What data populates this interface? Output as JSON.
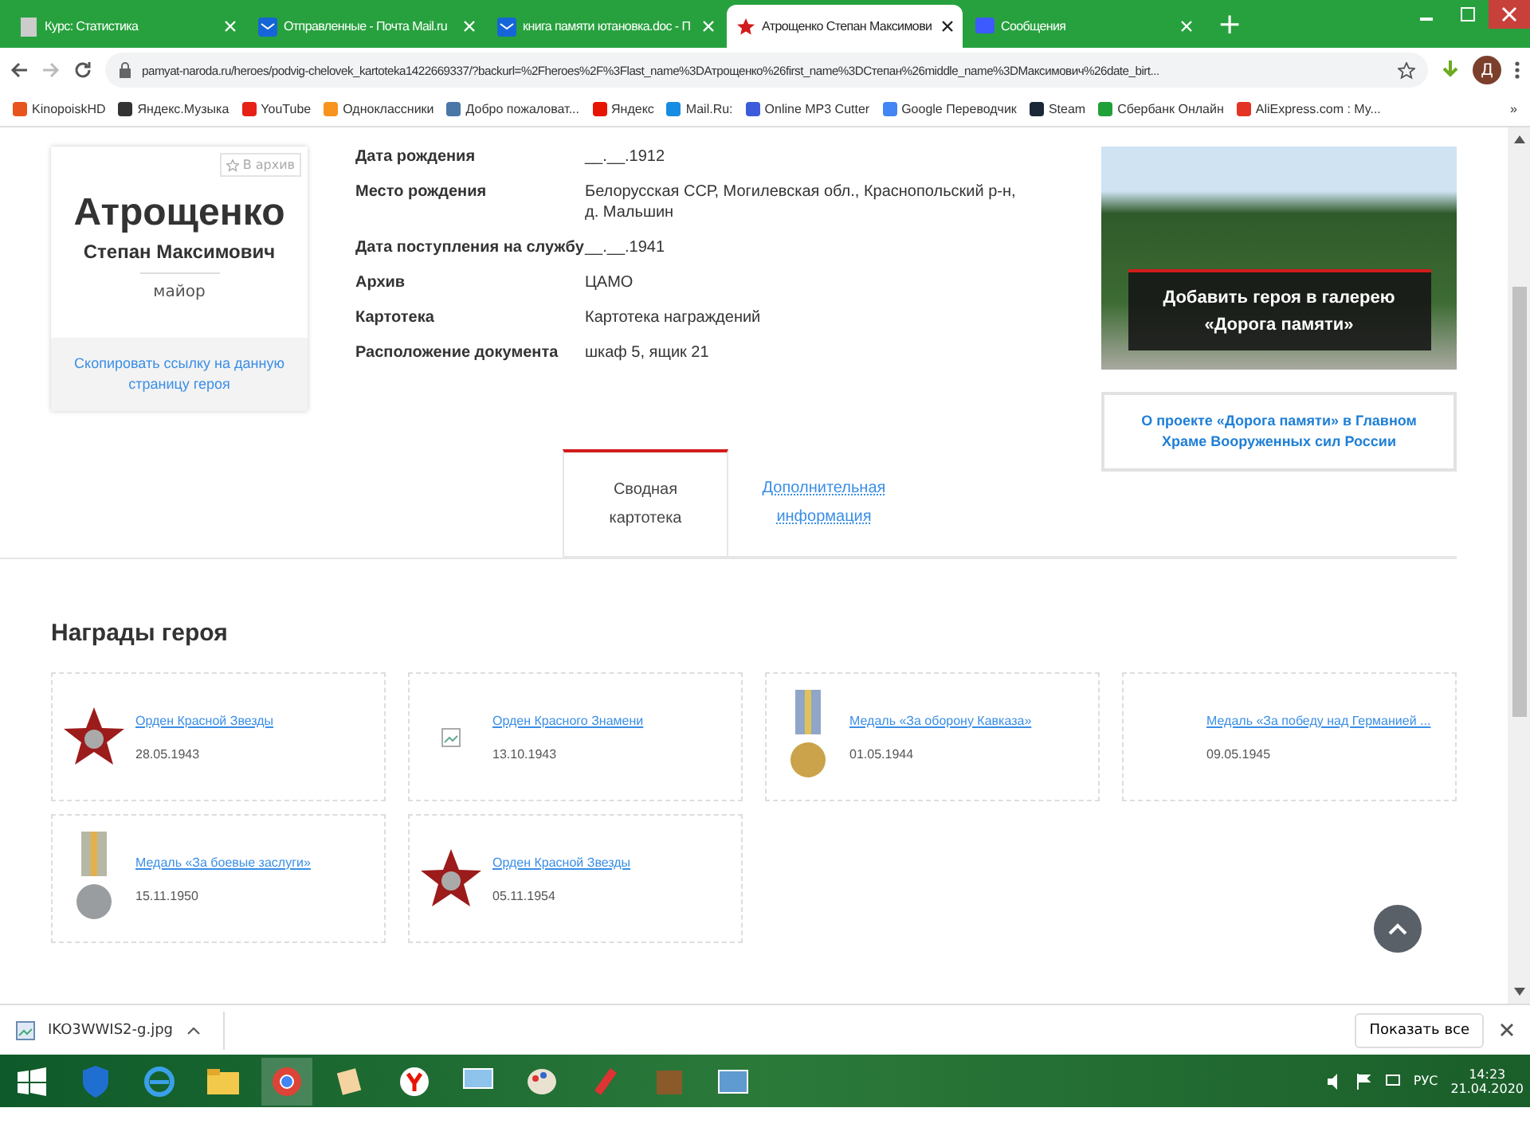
{
  "browser": {
    "tabs": [
      {
        "title": "Курс: Статистика",
        "selected": false,
        "kind": "doc"
      },
      {
        "title": "Отправленные - Почта Mail.ru",
        "selected": false,
        "kind": "mail"
      },
      {
        "title": "книга памяти ютановка.doc - П",
        "selected": false,
        "kind": "mail"
      },
      {
        "title": "Атрощенко Степан Максимови",
        "selected": true,
        "kind": "star"
      },
      {
        "title": "Сообщения",
        "selected": false,
        "kind": "chat"
      }
    ],
    "new_tab": "+",
    "url": "pamyat-naroda.ru/heroes/podvig-chelovek_kartoteka1422669337/?backurl=%2Fheroes%2F%3Flast_name%3DАтрощенко%26first_name%3DСтепан%26middle_name%3DМаксимович%26date_birt...",
    "profile": "Д",
    "bookmarks": [
      {
        "title": "KinopoiskHD",
        "color": "#e8541e"
      },
      {
        "title": "Яндекс.Музыка",
        "color": "#333333"
      },
      {
        "title": "YouTube",
        "color": "#e62117"
      },
      {
        "title": "Одноклассники",
        "color": "#f7931e"
      },
      {
        "title": "Добро пожаловат...",
        "color": "#4a76a8"
      },
      {
        "title": "Яндекс",
        "color": "#e61400"
      },
      {
        "title": "Mail.Ru:",
        "color": "#168de2"
      },
      {
        "title": "Online MP3 Cutter",
        "color": "#3b5bdb"
      },
      {
        "title": "Google Переводчик",
        "color": "#4285f4"
      },
      {
        "title": "Steam",
        "color": "#1b2838"
      },
      {
        "title": "Сбербанк Онлайн",
        "color": "#21a038"
      },
      {
        "title": "AliExpress.com : My...",
        "color": "#e43225"
      }
    ],
    "more": "»"
  },
  "hero": {
    "archive_button": "В архив",
    "surname": "Атрощенко",
    "names": "Степан Максимович",
    "rank": "майор",
    "copy_link": "Скопировать ссылку на данную страницу героя"
  },
  "details": [
    {
      "label": "Дата рождения",
      "value": "__.__.1912"
    },
    {
      "label": "Место рождения",
      "value": "Белорусская ССР, Могилевская обл., Краснопольский р-н, д. Мальшин"
    },
    {
      "label": "Дата поступления на службу",
      "value": "__.__.1941"
    },
    {
      "label": "Архив",
      "value": "ЦАМО"
    },
    {
      "label": "Картотека",
      "value": "Картотека награждений"
    },
    {
      "label": "Расположение документа",
      "value": "шкаф 5, ящик 21"
    }
  ],
  "gallery_banner": {
    "text": "Добавить героя в галерею «Дорога памяти»"
  },
  "about_link": "О проекте «Дорога памяти» в Главном Храме Вооруженных сил России",
  "page_tabs": [
    {
      "label": "Сводная картотека",
      "selected": true
    },
    {
      "label": "Дополнительная информация",
      "selected": false
    }
  ],
  "awards": {
    "title": "Награды героя",
    "items": [
      {
        "name": "Орден Красной Звезды",
        "date": "28.05.1943",
        "kind": "star"
      },
      {
        "name": "Орден Красного Знамени",
        "date": "13.10.1943",
        "kind": "broken"
      },
      {
        "name": "Медаль «За оборону Кавказа»",
        "date": "01.05.1944",
        "kind": "gold"
      },
      {
        "name": "Медаль «За победу над Германией ...",
        "date": "09.05.1945",
        "kind": "none"
      },
      {
        "name": "Медаль «За боевые заслуги»",
        "date": "15.11.1950",
        "kind": "silver"
      },
      {
        "name": "Орден Красной Звезды",
        "date": "05.11.1954",
        "kind": "star"
      }
    ]
  },
  "downloads": {
    "file": "IKO3WWIS2-g.jpg",
    "show_all": "Показать все"
  },
  "taskbar": {
    "language": "РУС",
    "time": "14:23",
    "date": "21.04.2020"
  }
}
